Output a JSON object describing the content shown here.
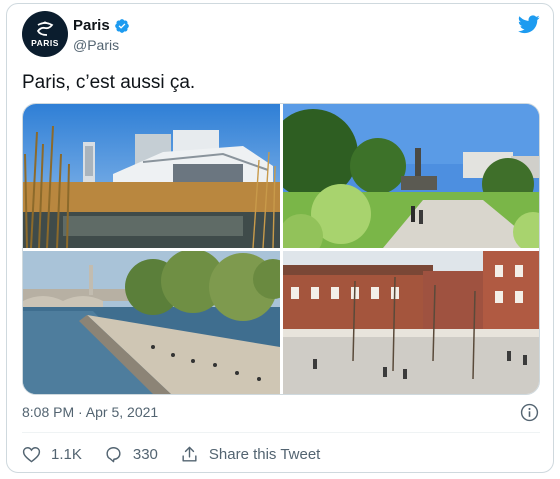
{
  "account": {
    "display_name": "Paris",
    "handle": "@Paris",
    "avatar_text": "PARIS"
  },
  "tweet": {
    "text": "Paris, c’est aussi ça.",
    "timestamp": "8:08 PM · Apr 5, 2021"
  },
  "media": {
    "photos": [
      {
        "subject": "modern-building-reeds"
      },
      {
        "subject": "park-statue"
      },
      {
        "subject": "river-quay"
      },
      {
        "subject": "brick-courtyard"
      }
    ]
  },
  "actions": {
    "like_count": "1.1K",
    "reply_count": "330",
    "share_label": "Share this Tweet"
  },
  "icons": [
    "verified-badge-icon",
    "twitter-bird-icon",
    "info-icon",
    "heart-icon",
    "reply-icon",
    "share-icon"
  ],
  "colors": {
    "twitter_blue": "#1d9bf0",
    "secondary_text": "#536471",
    "border": "#cfd9de"
  }
}
